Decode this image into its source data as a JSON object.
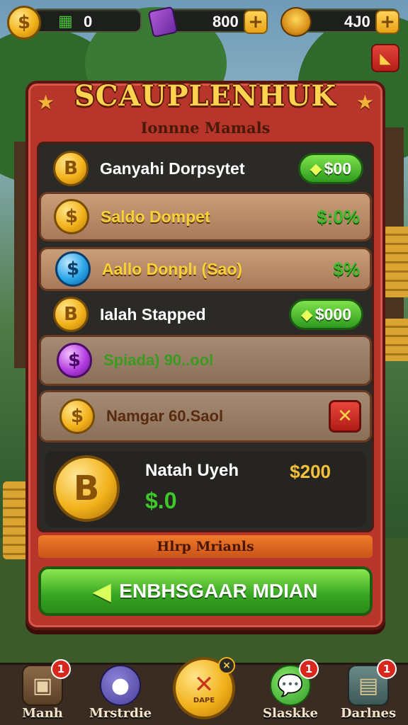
{
  "hud": {
    "cash": {
      "value": "0",
      "icon": "cash-icon"
    },
    "gems": {
      "value": "800",
      "icon": "gem-book-icon"
    },
    "coins": {
      "value": "4J0",
      "icon": "coin-bag-icon"
    },
    "coin_symbol": "$",
    "plus": "+"
  },
  "panel": {
    "title": "SCAUPLENHUK",
    "subtitle": "Ionnne Mamals",
    "rows": [
      {
        "coin": "B",
        "label": "Ganyahi Dorpsytet",
        "button": "$00",
        "button_icon": "arrow-icon"
      },
      {
        "coin": "$",
        "label": "Saldo Dompet",
        "amount": "$:0%"
      },
      {
        "coin": "$",
        "label": "Aallo Donplı (Sao)",
        "amount": "$%"
      },
      {
        "coin": "B",
        "label": "Ialah Stapped",
        "button": "$000",
        "button_icon": "arrow-icon"
      },
      {
        "coin": "$",
        "label": "Spiada) 90..ool"
      },
      {
        "coin": "$",
        "label": "Namgar 60.Saol",
        "close": "✕"
      }
    ],
    "summary": {
      "coin": "B",
      "label": "Natah Uyeh",
      "amount": "$200",
      "balance": "$.0"
    },
    "info": "Hlrp Mrianls",
    "cta": "ENBHSGAAR MDIAN"
  },
  "bottom_nav": {
    "items": [
      {
        "label": "Manh",
        "badge": "1",
        "icon": "chest-icon"
      },
      {
        "label": "Mrstrdie",
        "badge": "",
        "icon": "monster-icon"
      },
      {
        "label": "Slaskke",
        "badge": "1",
        "icon": "chat-icon"
      },
      {
        "label": "Darlnes",
        "badge": "1",
        "icon": "cash-register-icon"
      }
    ],
    "center": {
      "label": "DAPE",
      "icon": "x-icon",
      "close": "×"
    }
  },
  "colors": {
    "panel": "#b8352b",
    "gold": "#f2b21b",
    "green": "#3fb82a",
    "orange": "#f07a2a"
  }
}
